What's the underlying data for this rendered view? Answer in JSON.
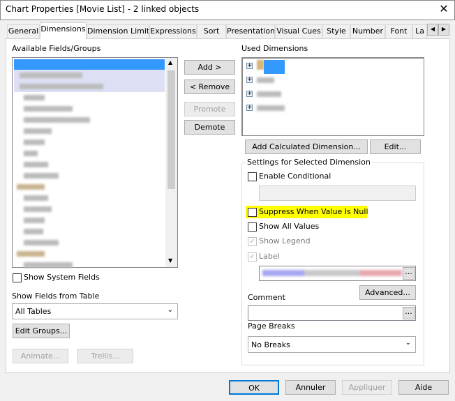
{
  "window": {
    "title": "Chart Properties [Movie List] - 2 linked objects"
  },
  "tabs": [
    {
      "label": "General"
    },
    {
      "label": "Dimensions"
    },
    {
      "label": "Dimension Limits"
    },
    {
      "label": "Expressions"
    },
    {
      "label": "Sort"
    },
    {
      "label": "Presentation"
    },
    {
      "label": "Visual Cues"
    },
    {
      "label": "Style"
    },
    {
      "label": "Number"
    },
    {
      "label": "Font"
    },
    {
      "label": "La"
    }
  ],
  "left": {
    "available_label": "Available Fields/Groups",
    "show_system_fields": "Show System Fields",
    "show_fields_from": "Show Fields from Table",
    "table_select": "All Tables",
    "edit_groups": "Edit Groups...",
    "animate": "Animate...",
    "trellis": "Trellis..."
  },
  "middle": {
    "add": "Add >",
    "remove": "< Remove",
    "promote": "Promote",
    "demote": "Demote"
  },
  "right": {
    "used_label": "Used Dimensions",
    "add_calc": "Add Calculated Dimension...",
    "edit": "Edit...",
    "settings": {
      "title": "Settings for Selected Dimension",
      "enable_conditional": "Enable Conditional",
      "suppress_null": "Suppress When Value Is Null",
      "show_all_values": "Show All Values",
      "show_legend": "Show Legend",
      "label": "Label",
      "ellipsis": "...",
      "advanced": "Advanced...",
      "comment": "Comment",
      "page_breaks": "Page Breaks",
      "page_breaks_value": "No Breaks"
    },
    "highlight_color": "#ffff00"
  },
  "footer": {
    "ok": "OK",
    "cancel": "Annuler",
    "apply": "Appliquer",
    "help": "Aide"
  }
}
